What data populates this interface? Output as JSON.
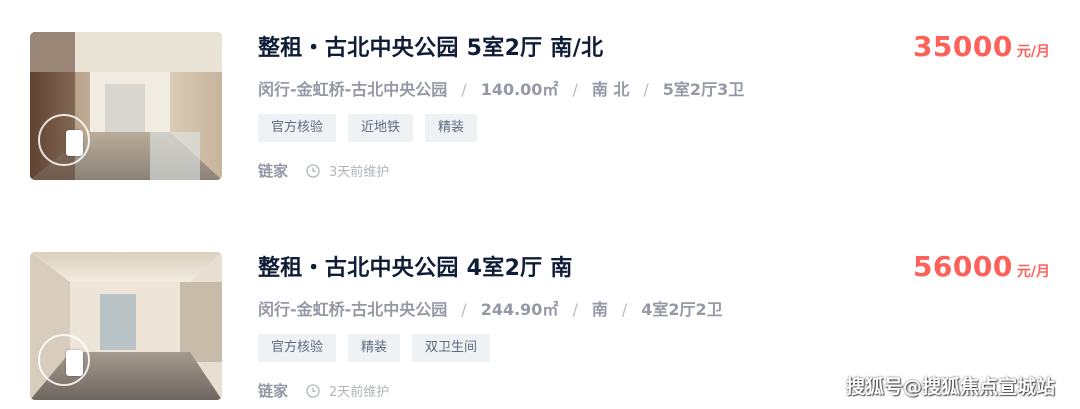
{
  "listings": [
    {
      "title": "整租・古北中央公园 5室2厅 南/北",
      "location": "闵行-金虹桥-古北中央公园",
      "area": "140.00㎡",
      "orientation": "南 北",
      "layout": "5室2厅3卫",
      "separator": "/",
      "tags": [
        "官方核验",
        "近地铁",
        "精装"
      ],
      "agency": "链家",
      "maintained": "3天前维护",
      "price": "35000",
      "price_unit": "元/月",
      "icons": {
        "vr": "vr-badge-icon",
        "clock": "clock-icon"
      }
    },
    {
      "title": "整租・古北中央公园 4室2厅 南",
      "location": "闵行-金虹桥-古北中央公园",
      "area": "244.90㎡",
      "orientation": "南",
      "layout": "4室2厅2卫",
      "separator": "/",
      "tags": [
        "官方核验",
        "精装",
        "双卫生间"
      ],
      "agency": "链家",
      "maintained": "2天前维护",
      "price": "56000",
      "price_unit": "元/月",
      "icons": {
        "vr": "vr-badge-icon",
        "clock": "clock-icon"
      }
    }
  ],
  "watermark": "搜狐号@搜狐焦点宣城站",
  "colors": {
    "price": "#fe615a",
    "title": "#101d37",
    "muted": "#9399a5",
    "tag_bg": "#eef2f5"
  }
}
